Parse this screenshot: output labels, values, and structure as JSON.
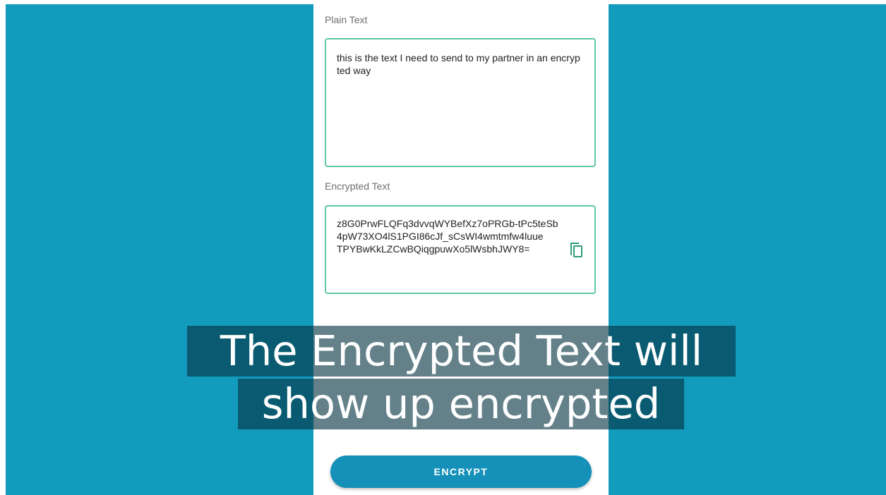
{
  "plain": {
    "label": "Plain Text",
    "value": "this is the text I need to send to my partner in an encrypted way"
  },
  "encrypted": {
    "label": "Encrypted Text",
    "value": "z8G0PrwFLQFq3dvvqWYBefXz7oPRGb-tPc5teSb4pW73XO4lS1PGI86cJf_sCsWI4wmtmfw4luue\nTPYBwKkLZCwBQiqgpuwXo5lWsbhJWY8=",
    "copy_icon": "copy-icon"
  },
  "actions": {
    "encrypt_label": "ENCRYPT"
  },
  "caption": {
    "line1": "The Encrypted Text will",
    "line2": "show up encrypted"
  },
  "colors": {
    "background": "#139bbd",
    "field_border": "#5ec8a7",
    "button": "#1590b8"
  }
}
